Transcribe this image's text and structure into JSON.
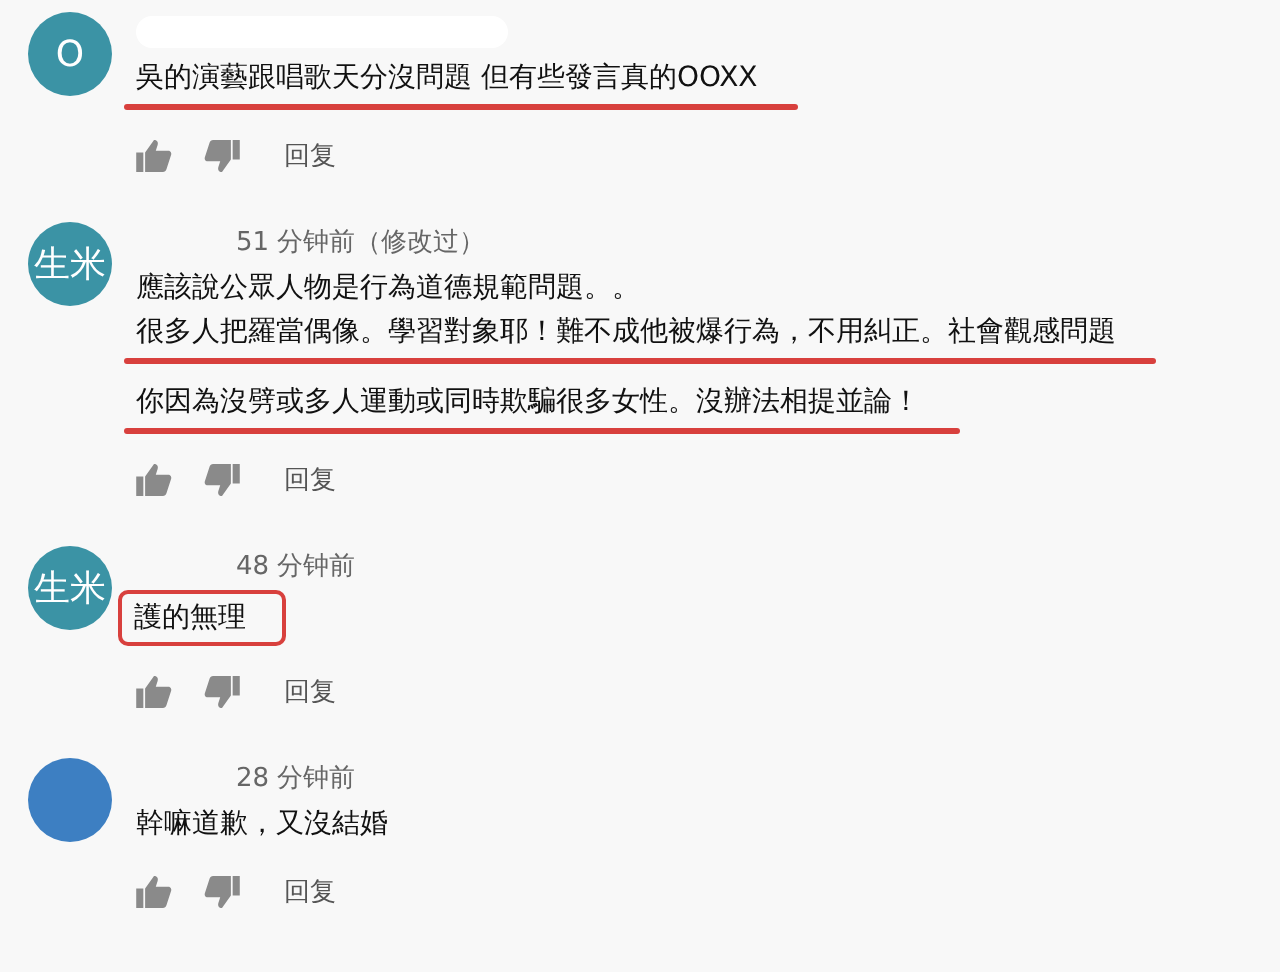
{
  "comments": [
    {
      "avatar": {
        "text": "O",
        "color": "#3b93a5"
      },
      "paragraphs": [
        [
          {
            "text": "吳的演藝跟唱歌天分沒問題  但有些發言真的OOXX",
            "kind": "underline"
          }
        ]
      ],
      "reply": "回复"
    },
    {
      "avatar": {
        "text": "生米",
        "color": "#3b93a5"
      },
      "time": "51 分钟前（修改过）",
      "paragraphs": [
        [
          {
            "text": "應該說公眾人物是行為道德規範問題。。",
            "kind": "plain"
          },
          {
            "text": "很多人把羅當偶像。學習對象耶！難不成他被爆行為，不用糾正。社會觀感問題",
            "kind": "underline"
          }
        ],
        [
          {
            "text": "你因為沒劈或多人運動或同時欺騙很多女性。沒辦法相提並論！",
            "kind": "underline"
          }
        ]
      ],
      "reply": "回复"
    },
    {
      "avatar": {
        "text": "生米",
        "color": "#3b93a5"
      },
      "time": "48 分钟前",
      "paragraphs": [
        [
          {
            "text": "護的無理",
            "kind": "box"
          }
        ]
      ],
      "reply": "回复"
    },
    {
      "avatar": {
        "color": "#3d7fc2"
      },
      "time": "28 分钟前",
      "paragraphs": [
        [
          {
            "text": "幹嘛道歉，又沒結婚",
            "kind": "plain"
          }
        ]
      ],
      "reply": "回复"
    }
  ]
}
